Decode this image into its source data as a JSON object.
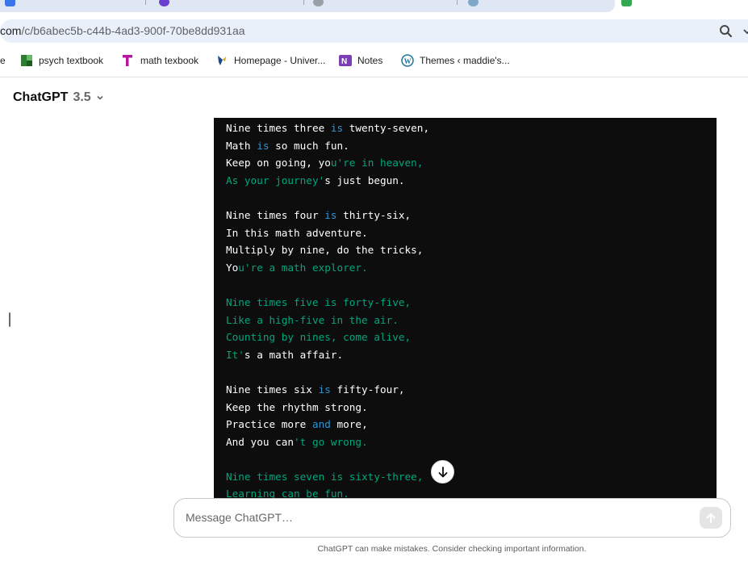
{
  "browser": {
    "address_bar": {
      "host_fragment": "com",
      "path": "/c/b6abec5b-c44b-4ad3-900f-70be8dd931aa"
    },
    "bookmarks": [
      {
        "label": "e",
        "icon": "bookmark-icon"
      },
      {
        "label": "psych textbook",
        "icon": "book-icon",
        "color": "#2e7d32"
      },
      {
        "label": "math texbook",
        "icon": "t-logo-icon",
        "color": "#b5179e"
      },
      {
        "label": "Homepage - Univer...",
        "icon": "university-icon",
        "color": "#1a4b8c"
      },
      {
        "label": "Notes",
        "icon": "onenote-icon",
        "color": "#7b3fb8"
      },
      {
        "label": "Themes ‹ maddie's...",
        "icon": "wordpress-icon",
        "color": "#21759b"
      }
    ]
  },
  "header": {
    "model_name": "ChatGPT",
    "model_version": "3.5"
  },
  "code_block": {
    "lines": [
      [
        {
          "t": "Nine times three "
        },
        {
          "t": "is",
          "c": "kw"
        },
        {
          "t": " twenty-seven,"
        }
      ],
      [
        {
          "t": "Math "
        },
        {
          "t": "is",
          "c": "kw"
        },
        {
          "t": " so much fun."
        }
      ],
      [
        {
          "t": "Keep on going, yo"
        },
        {
          "t": "u're in heaven,",
          "c": "str"
        }
      ],
      [
        {
          "t": "As your journey'",
          "c": "str"
        },
        {
          "t": "s just begun."
        }
      ],
      [],
      [
        {
          "t": "Nine times four "
        },
        {
          "t": "is",
          "c": "kw"
        },
        {
          "t": " thirty-six,"
        }
      ],
      [
        {
          "t": "In this math adventure."
        }
      ],
      [
        {
          "t": "Multiply by nine, do the tricks,"
        }
      ],
      [
        {
          "t": "Yo"
        },
        {
          "t": "u're a math explorer.",
          "c": "str"
        }
      ],
      [],
      [
        {
          "t": "Nine times five is forty-five,",
          "c": "str"
        }
      ],
      [
        {
          "t": "Like a high-five in the air.",
          "c": "str"
        }
      ],
      [
        {
          "t": "Counting by nines, come alive,",
          "c": "str"
        }
      ],
      [
        {
          "t": "It'",
          "c": "str"
        },
        {
          "t": "s a math affair."
        }
      ],
      [],
      [
        {
          "t": "Nine times six "
        },
        {
          "t": "is",
          "c": "kw"
        },
        {
          "t": " fifty-four,"
        }
      ],
      [
        {
          "t": "Keep the rhythm strong."
        }
      ],
      [
        {
          "t": "Practice more "
        },
        {
          "t": "and",
          "c": "kw"
        },
        {
          "t": " more,"
        }
      ],
      [
        {
          "t": "And you can"
        },
        {
          "t": "'t go wrong.",
          "c": "str"
        }
      ],
      [],
      [
        {
          "t": "Nine times seven is sixty-three,",
          "c": "str"
        }
      ],
      [
        {
          "t": "Learning can be fun.",
          "c": "str"
        }
      ]
    ]
  },
  "composer": {
    "placeholder": "Message ChatGPT…"
  },
  "footer": {
    "disclaimer": "ChatGPT can make mistakes. Consider checking important information."
  },
  "colors": {
    "code_background": "#0d0d0d",
    "code_keyword": "#2e95d3",
    "code_string": "#00a67d",
    "omnibox_background": "#eaf0f9"
  }
}
